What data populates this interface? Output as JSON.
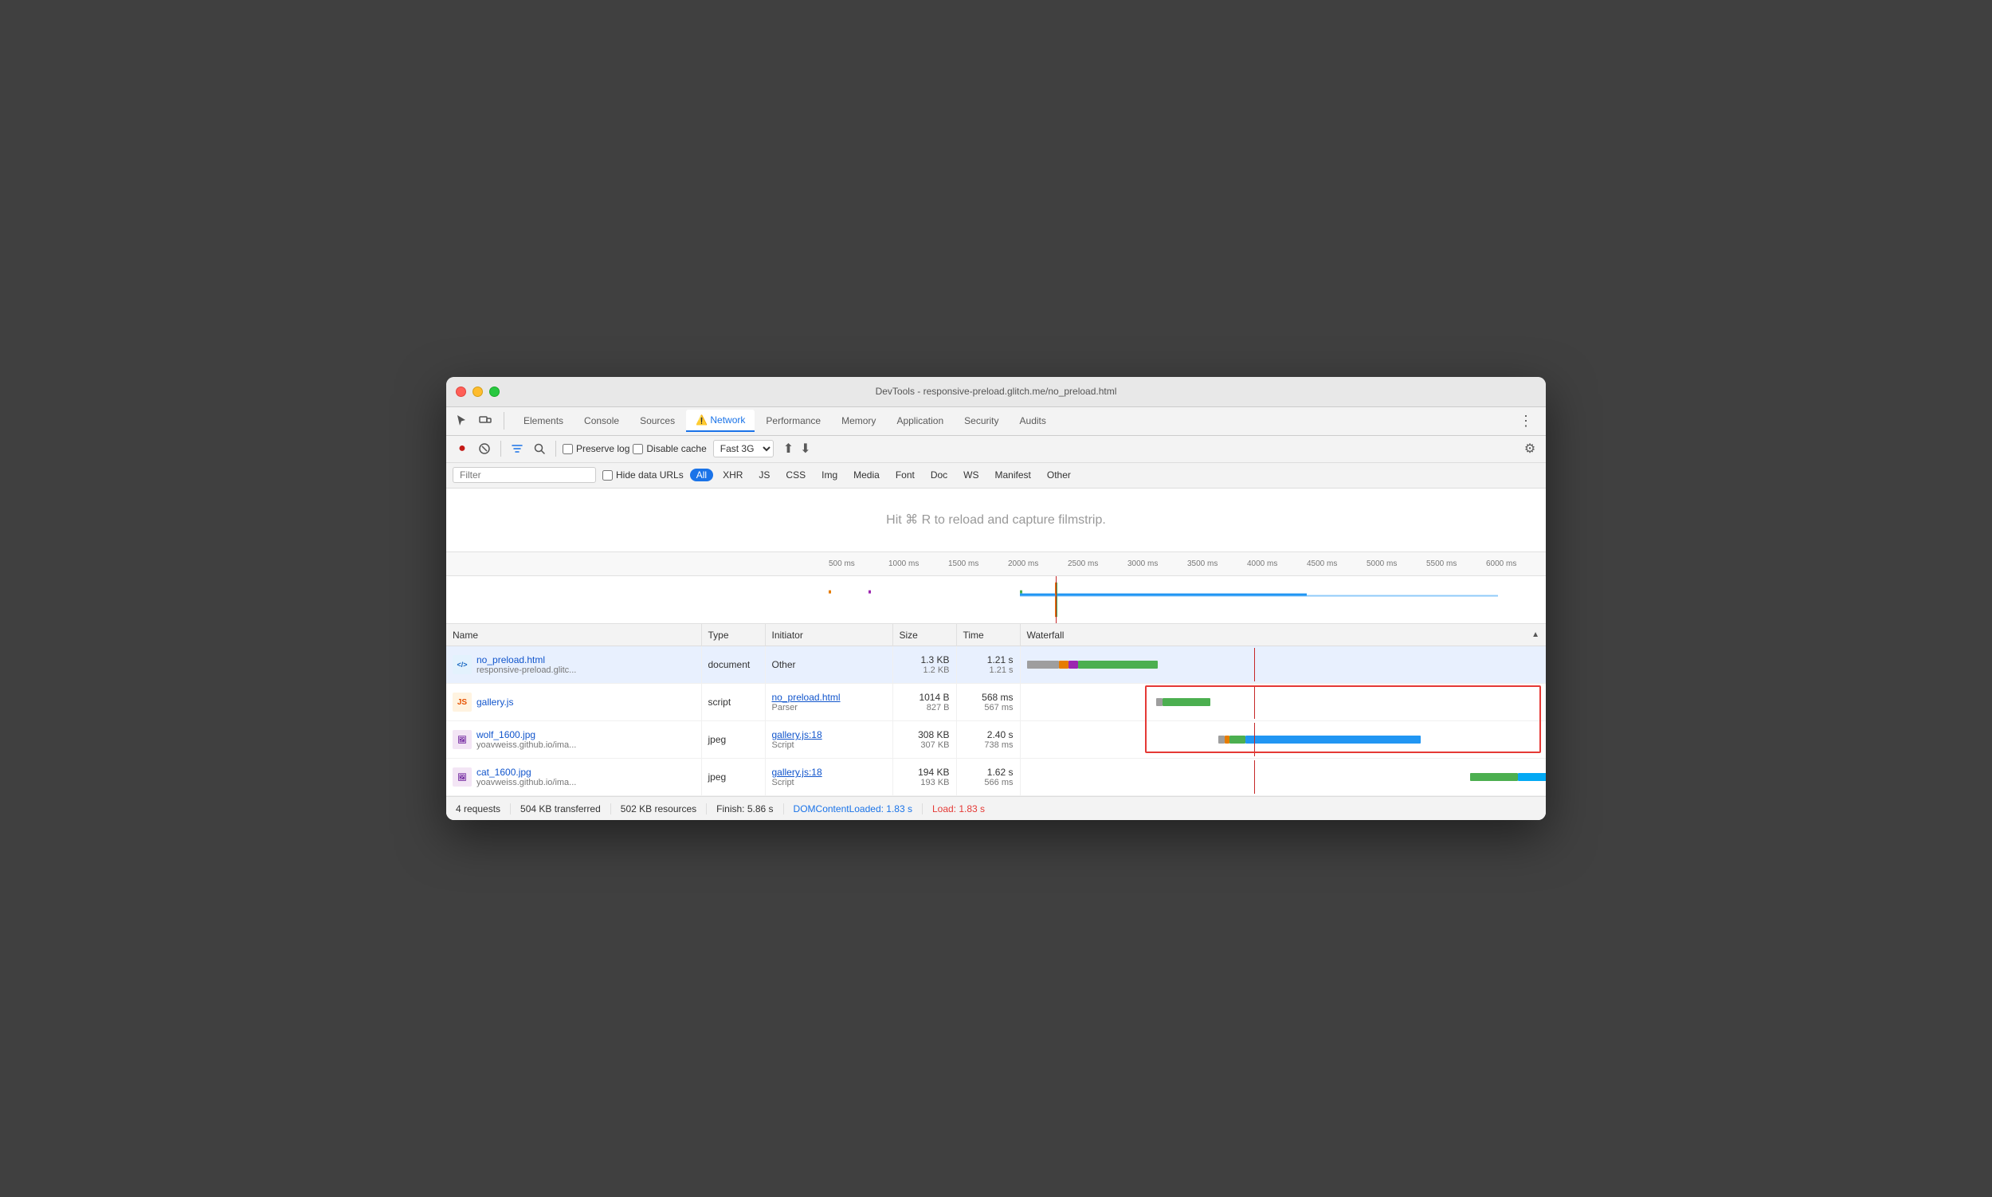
{
  "window": {
    "title": "DevTools - responsive-preload.glitch.me/no_preload.html"
  },
  "tabs": [
    {
      "id": "elements",
      "label": "Elements",
      "active": false
    },
    {
      "id": "console",
      "label": "Console",
      "active": false
    },
    {
      "id": "sources",
      "label": "Sources",
      "active": false
    },
    {
      "id": "network",
      "label": "Network",
      "active": true,
      "warning": true
    },
    {
      "id": "performance",
      "label": "Performance",
      "active": false
    },
    {
      "id": "memory",
      "label": "Memory",
      "active": false
    },
    {
      "id": "application",
      "label": "Application",
      "active": false
    },
    {
      "id": "security",
      "label": "Security",
      "active": false
    },
    {
      "id": "audits",
      "label": "Audits",
      "active": false
    }
  ],
  "toolbar": {
    "preserve_log": "Preserve log",
    "disable_cache": "Disable cache",
    "network_preset": "Fast 3G"
  },
  "filter": {
    "placeholder": "Filter",
    "hide_data_urls": "Hide data URLs",
    "tags": [
      "All",
      "XHR",
      "JS",
      "CSS",
      "Img",
      "Media",
      "Font",
      "Doc",
      "WS",
      "Manifest",
      "Other"
    ]
  },
  "filmstrip": {
    "hint": "Hit ⌘ R to reload and capture filmstrip."
  },
  "ruler": {
    "labels": [
      "500 ms",
      "1000 ms",
      "1500 ms",
      "2000 ms",
      "2500 ms",
      "3000 ms",
      "3500 ms",
      "4000 ms",
      "4500 ms",
      "5000 ms",
      "5500 ms",
      "6000 ms"
    ]
  },
  "table": {
    "columns": [
      "Name",
      "Type",
      "Initiator",
      "Size",
      "Time",
      "Waterfall"
    ],
    "rows": [
      {
        "name": "no_preload.html",
        "url": "responsive-preload.glitc...",
        "type": "document",
        "initiator": "Other",
        "initiator_link": false,
        "size1": "1.3 KB",
        "size2": "1.2 KB",
        "time1": "1.21 s",
        "time2": "1.21 s",
        "icon": "html",
        "selected": true
      },
      {
        "name": "gallery.js",
        "url": "",
        "type": "script",
        "initiator": "no_preload.html",
        "initiator_sub": "Parser",
        "initiator_link": true,
        "size1": "1014 B",
        "size2": "827 B",
        "time1": "568 ms",
        "time2": "567 ms",
        "icon": "js",
        "selected": false
      },
      {
        "name": "wolf_1600.jpg",
        "url": "yoavweiss.github.io/ima...",
        "type": "jpeg",
        "initiator": "gallery.js:18",
        "initiator_sub": "Script",
        "initiator_link": true,
        "size1": "308 KB",
        "size2": "307 KB",
        "time1": "2.40 s",
        "time2": "738 ms",
        "icon": "img",
        "selected": false
      },
      {
        "name": "cat_1600.jpg",
        "url": "yoavweiss.github.io/ima...",
        "type": "jpeg",
        "initiator": "gallery.js:18",
        "initiator_sub": "Script",
        "initiator_link": true,
        "size1": "194 KB",
        "size2": "193 KB",
        "time1": "1.62 s",
        "time2": "566 ms",
        "icon": "img",
        "selected": false
      }
    ]
  },
  "status": {
    "requests": "4 requests",
    "transferred": "504 KB transferred",
    "resources": "502 KB resources",
    "finish": "Finish: 5.86 s",
    "dom_content_loaded": "DOMContentLoaded: 1.83 s",
    "load": "Load: 1.83 s"
  }
}
